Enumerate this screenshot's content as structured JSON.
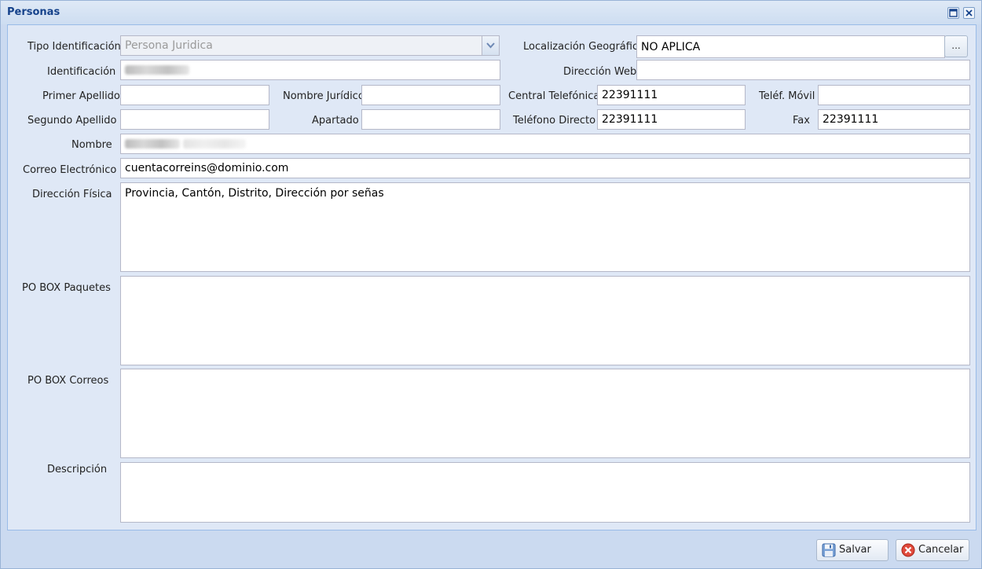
{
  "window": {
    "title": "Personas"
  },
  "form": {
    "tipo_identificacion": {
      "label": "Tipo Identificación",
      "value": "Persona Juridica"
    },
    "localizacion": {
      "label": "Localización Geográfica",
      "value": "NO APLICA",
      "button": "..."
    },
    "identificacion": {
      "label": "Identificación",
      "value": ""
    },
    "direccion_web": {
      "label": "Dirección Web",
      "value": ""
    },
    "primer_apellido": {
      "label": "Primer Apellido",
      "value": ""
    },
    "nombre_juridico": {
      "label": "Nombre Jurídico",
      "value": ""
    },
    "central_telefonica": {
      "label": "Central Telefónica",
      "value": "22391111"
    },
    "telef_movil": {
      "label": "Teléf. Móvil",
      "value": ""
    },
    "segundo_apellido": {
      "label": "Segundo Apellido",
      "value": ""
    },
    "apartado": {
      "label": "Apartado",
      "value": ""
    },
    "telefono_directo": {
      "label": "Teléfono Directo",
      "value": "22391111"
    },
    "fax": {
      "label": "Fax",
      "value": "22391111"
    },
    "nombre": {
      "label": "Nombre",
      "value": ""
    },
    "correo": {
      "label": "Correo Electrónico",
      "value": "cuentacorreins@dominio.com"
    },
    "direccion_fisica": {
      "label": "Dirección Física",
      "value": "Provincia, Cantón, Distrito, Dirección por señas"
    },
    "po_box_paquetes": {
      "label": "PO BOX Paquetes",
      "value": ""
    },
    "po_box_correos": {
      "label": "PO BOX Correos",
      "value": ""
    },
    "descripcion": {
      "label": "Descripción",
      "value": ""
    }
  },
  "footer": {
    "save_label": "Salvar",
    "cancel_label": "Cancelar"
  },
  "icons": {
    "maximize": "maximize-icon",
    "close": "close-icon",
    "dropdown": "chevron-down-icon",
    "save": "floppy-disk-icon",
    "cancel": "cancel-icon"
  },
  "colors": {
    "title": "#15428b",
    "panel": "#dfe8f6",
    "window": "#cbdaf0"
  }
}
